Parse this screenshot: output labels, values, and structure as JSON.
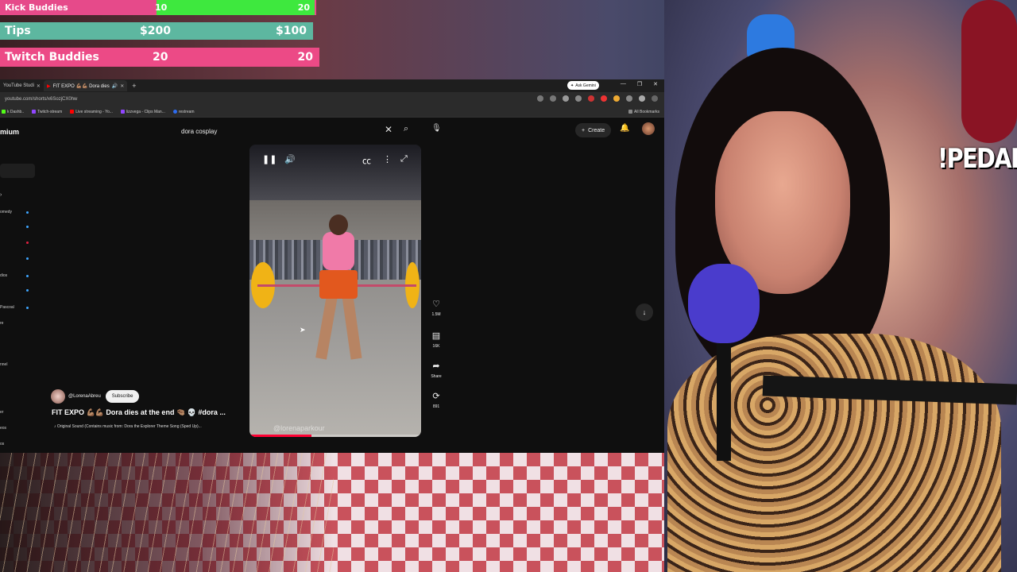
{
  "overlay": {
    "kick": {
      "label": "Kick Buddies",
      "current": "10",
      "goal": "20",
      "progress": 0.5
    },
    "tips": {
      "label": "Tips",
      "current": "$200",
      "goal": "$100"
    },
    "twitch": {
      "label": "Twitch Buddies",
      "current": "20",
      "goal": "20"
    },
    "command": "!PEDAL"
  },
  "browser": {
    "tabs": [
      {
        "label": "YouTube Studi",
        "active": false
      },
      {
        "label": "FIT EXPO 💪🏽💪🏽 Dora dies",
        "active": true
      }
    ],
    "gemini_label": "Ask Gemini",
    "url": "youtube.com/shorts/x6SozjCX0hw",
    "bookmarks": [
      {
        "label": "k Dashb..",
        "color": "#53fc18"
      },
      {
        "label": "Twitch-stream",
        "color": "#9146ff"
      },
      {
        "label": "Live streaming - Yo...",
        "color": "#ff0000"
      },
      {
        "label": "lizzvega - Clips Man...",
        "color": "#9146ff"
      },
      {
        "label": "restream",
        "color": "#2d6cf0"
      }
    ],
    "all_bookmarks": "All Bookmarks"
  },
  "youtube": {
    "brand": "mium",
    "search_query": "dora cosplay",
    "create_label": "Create",
    "sidebar": [
      {
        "label": "omedy",
        "dot": true
      },
      {
        "label": "dios",
        "dot": true
      },
      {
        "label": "Pascoal",
        "dot": true
      },
      {
        "label": "re",
        "dot": false
      },
      {
        "label": "nnel",
        "dot": false
      },
      {
        "label": "er",
        "dot": false
      },
      {
        "label": "eos",
        "dot": false
      },
      {
        "label": "os",
        "dot": false
      }
    ],
    "short": {
      "watermark": "@lorenaparkour",
      "progress": 0.36,
      "channel": "@LorenaAbreu",
      "subscribe": "Subscribe",
      "title": "FIT EXPO 💪🏽💪🏽 Dora dies at the end 🤏🏽 💀 #dora ...",
      "sound": "♪ Original Sound (Contains music from: Dora the Explorer Theme Song (Sped Up)..."
    },
    "actions": [
      {
        "icon": "heart-icon",
        "count": "1.5M"
      },
      {
        "icon": "comment-icon",
        "count": "16K"
      },
      {
        "icon": "share-icon",
        "count": "Share"
      },
      {
        "icon": "remix-icon",
        "count": "891"
      }
    ]
  }
}
